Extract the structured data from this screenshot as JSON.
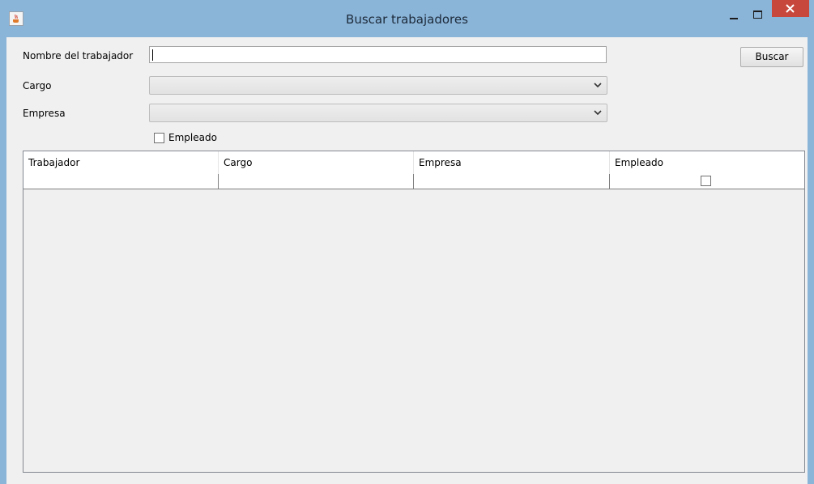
{
  "window": {
    "title": "Buscar trabajadores"
  },
  "form": {
    "nombre_label": "Nombre del trabajador",
    "nombre_value": "",
    "cargo_label": "Cargo",
    "cargo_selected": "",
    "empresa_label": "Empresa",
    "empresa_selected": "",
    "empleado_label": "Empleado",
    "empleado_checked": false,
    "buscar_label": "Buscar"
  },
  "table": {
    "columns": [
      "Trabajador",
      "Cargo",
      "Empresa",
      "Empleado"
    ],
    "rows": [
      {
        "trabajador": "",
        "cargo": "",
        "empresa": "",
        "empleado": false
      }
    ]
  },
  "icons": {
    "app": "java-cup-icon",
    "minimize": "minimize-icon",
    "maximize": "maximize-icon",
    "close": "close-icon",
    "combo_arrow": "chevron-down-icon"
  },
  "colors": {
    "titlebar": "#8ab4d8",
    "close_button": "#c7473c",
    "client_bg": "#f0f0f0"
  }
}
